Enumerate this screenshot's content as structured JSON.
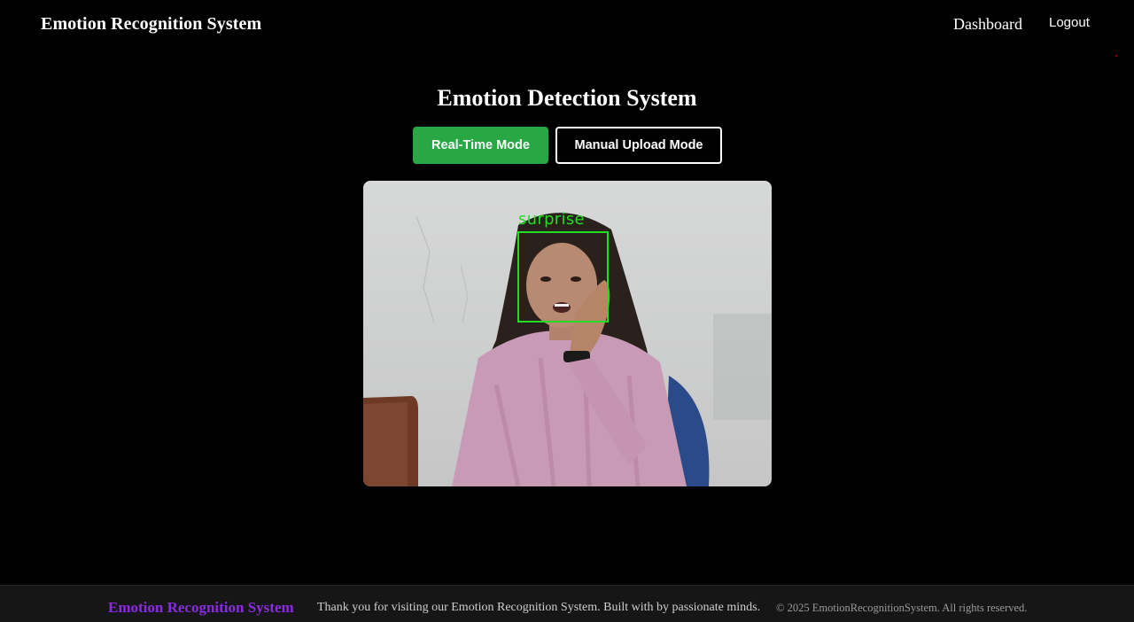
{
  "navbar": {
    "brand": "Emotion Recognition System",
    "links": [
      {
        "label": "Dashboard"
      },
      {
        "label": "Logout"
      }
    ]
  },
  "main": {
    "title": "Emotion Detection System",
    "modes": [
      {
        "label": "Real-Time Mode",
        "active": true
      },
      {
        "label": "Manual Upload Mode",
        "active": false
      }
    ],
    "video": {
      "detected_emotion": "surprise",
      "box_color": "#22dd22"
    }
  },
  "footer": {
    "brand": "Emotion Recognition System",
    "message": "Thank you for visiting our Emotion Recognition System. Built with by passionate minds.",
    "copyright": "© 2025 EmotionRecognitionSystem. All rights reserved."
  },
  "colors": {
    "accent_green": "#28a745",
    "footer_brand": "#8a2be2",
    "background": "#000000"
  }
}
